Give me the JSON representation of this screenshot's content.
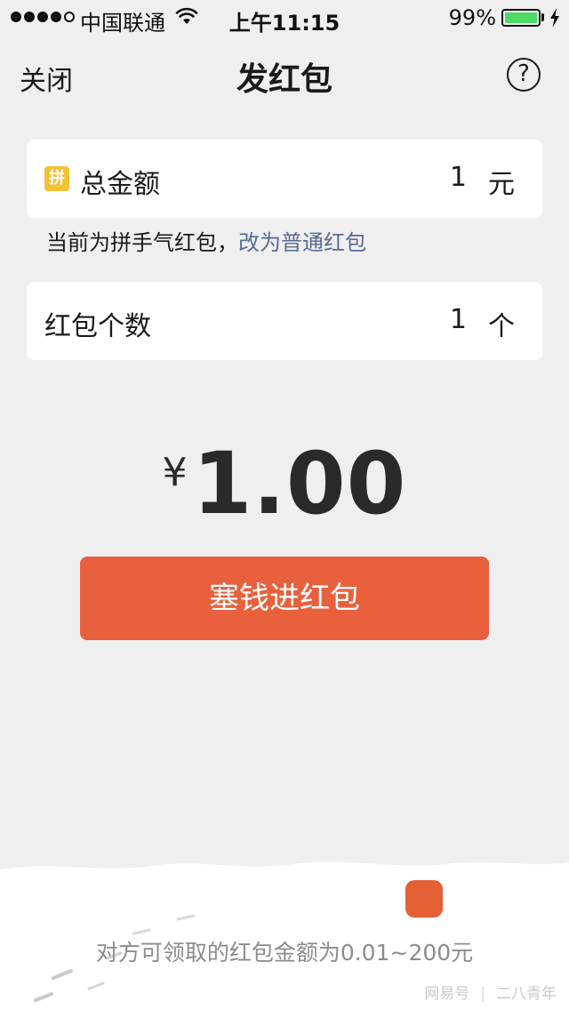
{
  "status_bar": {
    "carrier": "中国联通",
    "time": "上午11:15",
    "battery_percent": "99%",
    "battery_level": 0.99,
    "signal_bars_filled": 4,
    "signal_bars_total": 5
  },
  "nav": {
    "close_label": "关闭",
    "title": "发红包",
    "help_symbol": "?"
  },
  "amount_card": {
    "badge": "拼",
    "label": "总金额",
    "value": "1",
    "unit": "元"
  },
  "hint": {
    "text": "当前为拼手气红包，",
    "link": "改为普通红包"
  },
  "count_card": {
    "label": "红包个数",
    "value": "1",
    "unit": "个"
  },
  "total": {
    "currency": "¥",
    "value": "1.00"
  },
  "submit_label": "塞钱进红包",
  "footer_note": "对方可领取的红包金额为0.01~200元",
  "watermark": {
    "left": "网易号",
    "right": "二八青年"
  },
  "colors": {
    "accent": "#e9603d",
    "link": "#576b95",
    "background": "#efefef",
    "badge": "#f5c033"
  }
}
